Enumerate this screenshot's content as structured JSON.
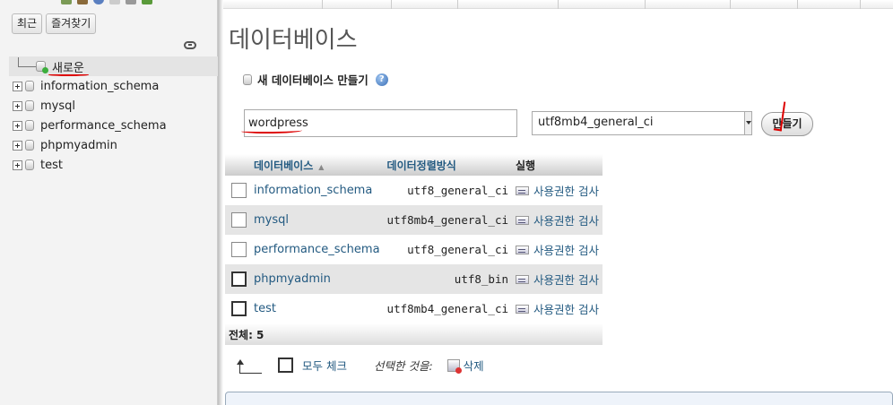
{
  "nav": {
    "buttons": {
      "recent": "최근",
      "favorites": "즐겨찾기"
    },
    "new_label": "새로운",
    "databases": [
      "information_schema",
      "mysql",
      "performance_schema",
      "phpmyadmin",
      "test"
    ]
  },
  "main": {
    "title": "데이터베이스",
    "create": {
      "heading": "새 데이터베이스 만들기",
      "db_name_value": "wordpress",
      "collation_value": "utf8mb4_general_ci",
      "button_label": "만들기"
    },
    "table": {
      "headers": {
        "database": "데이터베이스",
        "collation": "데이터정렬방식",
        "action": "실행"
      },
      "rows": [
        {
          "name": "information_schema",
          "collation": "utf8_general_ci",
          "action": "사용권한 검사"
        },
        {
          "name": "mysql",
          "collation": "utf8mb4_general_ci",
          "action": "사용권한 검사"
        },
        {
          "name": "performance_schema",
          "collation": "utf8_general_ci",
          "action": "사용권한 검사"
        },
        {
          "name": "phpmyadmin",
          "collation": "utf8_bin",
          "action": "사용권한 검사"
        },
        {
          "name": "test",
          "collation": "utf8mb4_general_ci",
          "action": "사용권한 검사"
        }
      ],
      "total": "전체: 5"
    },
    "bulk": {
      "check_all": "모두 체크",
      "with_selected": "선택한 것을:",
      "drop": "삭제"
    }
  },
  "colors": {
    "link": "#235a81",
    "annotation": "#dd0000"
  }
}
